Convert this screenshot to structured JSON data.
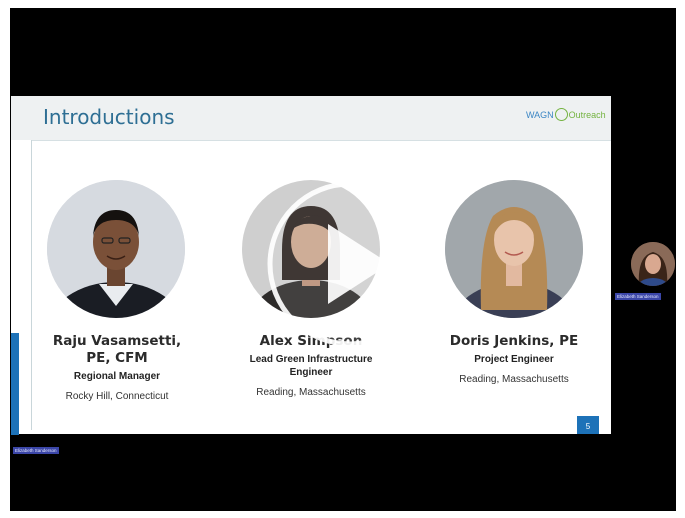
{
  "slide": {
    "title": "Introductions",
    "logo": {
      "left_text": "WAGN",
      "right_text": "Outreach"
    },
    "page_number": "5"
  },
  "people": [
    {
      "name_line1": "Raju Vasamsetti,",
      "name_line2": "PE, CFM",
      "role": "Regional Manager",
      "location": "Rocky Hill, Connecticut"
    },
    {
      "name_line1": "Alex Simpson",
      "name_line2": "",
      "role": "Lead Green Infrastructure Engineer",
      "location": "Reading, Massachusetts"
    },
    {
      "name_line1": "Doris Jenkins, PE",
      "name_line2": "",
      "role": "Project Engineer",
      "location": "Reading, Massachusetts"
    }
  ],
  "participants": {
    "remote_tag": "Elizabeth Sanderson",
    "local_tag": "Elizabeth Sanderson"
  },
  "colors": {
    "title": "#2e6f94",
    "accent_blue": "#1d72b8",
    "logo_green": "#74b341",
    "header_bg": "#eef1f2",
    "nametag_bg": "#3b46a8"
  },
  "icons": [
    "play-icon",
    "person-photo"
  ]
}
